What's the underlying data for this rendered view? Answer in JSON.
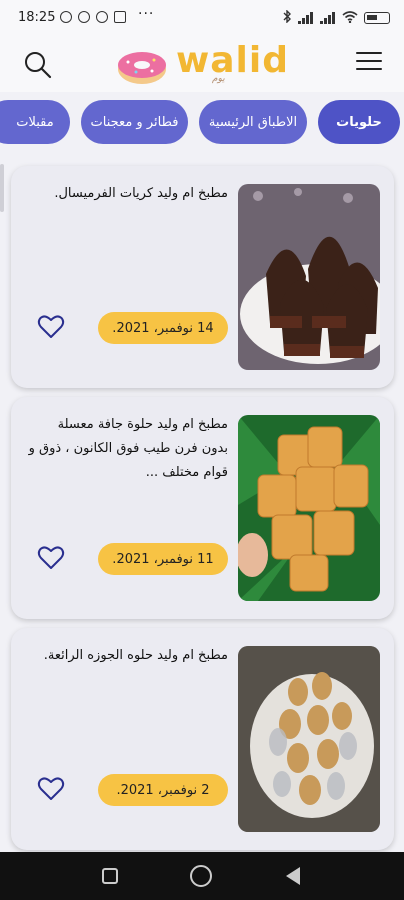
{
  "status_bar": {
    "time": "18:25",
    "dots": "···",
    "battery": "60"
  },
  "header": {
    "logo_text": "walid",
    "logo_sub": "يوم",
    "search_icon": "search-icon",
    "menu_icon": "hamburger-menu-icon"
  },
  "categories": [
    {
      "label": "حلويات",
      "active": true
    },
    {
      "label": "الاطباق الرئيسية",
      "active": false
    },
    {
      "label": "فطائر و معجنات",
      "active": false
    },
    {
      "label": "مقبلات",
      "active": false
    }
  ],
  "cards": [
    {
      "title": "مطبخ ام وليد كريات الفرميسال.",
      "date": "14 نوفمبر، 2021.",
      "image": "chocolate-vermicelli-balls-photo"
    },
    {
      "title": "مطبخ ام وليد حلوة جافة معسلة بدون فرن طيب فوق الكانون ، ذوق و قوام مختلف ...",
      "date": "11 نوفمبر، 2021.",
      "image": "waffle-biscuits-photo"
    },
    {
      "title": "مطبخ ام وليد حلوه الجوزه الرائعة.",
      "date": "2 نوفمبر، 2021.",
      "image": "walnut-sweets-plate-photo"
    }
  ],
  "colors": {
    "chip": "#6367cf",
    "chip_active": "#4e53c6",
    "badge": "#f7c344",
    "logo": "#f2b733",
    "heart": "#2a2f8f"
  }
}
